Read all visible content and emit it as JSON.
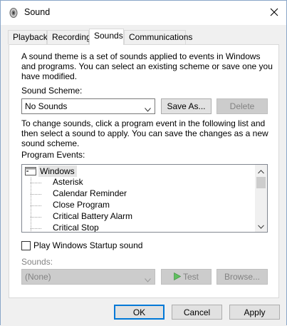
{
  "window": {
    "title": "Sound"
  },
  "tabs": [
    {
      "label": "Playback"
    },
    {
      "label": "Recording"
    },
    {
      "label": "Sounds"
    },
    {
      "label": "Communications"
    }
  ],
  "active_tab": "Sounds",
  "intro_text": [
    "A sound theme is a set of sounds applied to events in Windows",
    "and programs.  You can select an existing scheme or save one you",
    "have modified."
  ],
  "scheme": {
    "label": "Sound Scheme:",
    "value": "No Sounds",
    "save_as_label": "Save As...",
    "delete_label": "Delete"
  },
  "instructions_text": [
    "To change sounds, click a program event in the following list and",
    "then select a sound to apply.  You can save the changes as a new",
    "sound scheme."
  ],
  "program_events": {
    "label": "Program Events:",
    "group": "Windows",
    "items": [
      "Asterisk",
      "Calendar Reminder",
      "Close Program",
      "Critical Battery Alarm",
      "Critical Stop"
    ]
  },
  "startup": {
    "label": "Play Windows Startup sound",
    "checked": false
  },
  "sounds": {
    "label": "Sounds:",
    "value": "(None)",
    "test_label": "Test",
    "browse_label": "Browse..."
  },
  "footer": {
    "ok_label": "OK",
    "cancel_label": "Cancel",
    "apply_label": "Apply"
  },
  "colors": {
    "accent": "#0078d7",
    "selection": "#e5e5e5",
    "disabled_text": "#838383"
  }
}
